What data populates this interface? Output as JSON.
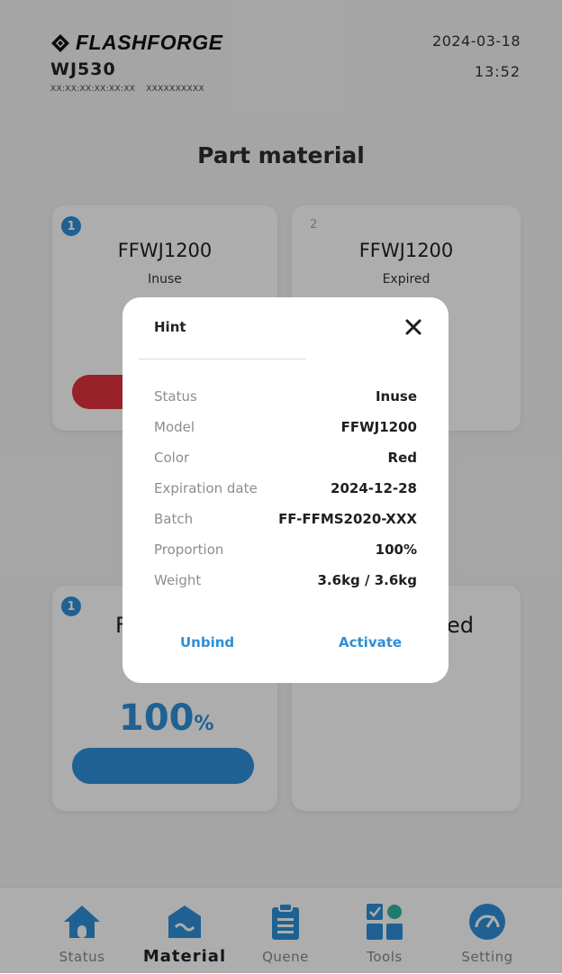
{
  "header": {
    "brand": "FLASHFORGE",
    "device": "WJ530",
    "serial_a": "XX:XX:XX:XX:XX:XX",
    "serial_b": "XXXXXXXXXX",
    "date": "2024-03-18",
    "time": "13:52"
  },
  "page_title": "Part material",
  "cards": [
    {
      "slot": "1",
      "model": "FFWJ1200",
      "status": "Inuse",
      "color": "#e0323e"
    },
    {
      "slot": "2",
      "model": "FFWJ1200",
      "status": "Expired"
    },
    {
      "slot": "1",
      "model_fragment": "F",
      "status_fragment": "ed",
      "percent": "100",
      "percent_unit": "%",
      "color": "#2e8fd8"
    },
    {
      "slot": "",
      "model": "",
      "status": ""
    }
  ],
  "dialog": {
    "title": "Hint",
    "rows": [
      {
        "key": "Status",
        "value": "Inuse"
      },
      {
        "key": "Model",
        "value": "FFWJ1200"
      },
      {
        "key": "Color",
        "value": "Red"
      },
      {
        "key": "Expiration date",
        "value": "2024-12-28"
      },
      {
        "key": "Batch",
        "value": "FF-FFMS2020-XXX"
      },
      {
        "key": "Proportion",
        "value": "100%"
      },
      {
        "key": "Weight",
        "value": "3.6kg / 3.6kg"
      }
    ],
    "unbind_label": "Unbind",
    "activate_label": "Activate"
  },
  "nav": [
    {
      "label": "Status",
      "icon": "home-icon",
      "active": false
    },
    {
      "label": "Material",
      "icon": "material-icon",
      "active": true
    },
    {
      "label": "Quene",
      "icon": "clipboard-icon",
      "active": false
    },
    {
      "label": "Tools",
      "icon": "tools-grid-icon",
      "active": false
    },
    {
      "label": "Setting",
      "icon": "gauge-icon",
      "active": false
    }
  ],
  "colors": {
    "accent": "#2e8fd8",
    "danger": "#e0323e"
  }
}
